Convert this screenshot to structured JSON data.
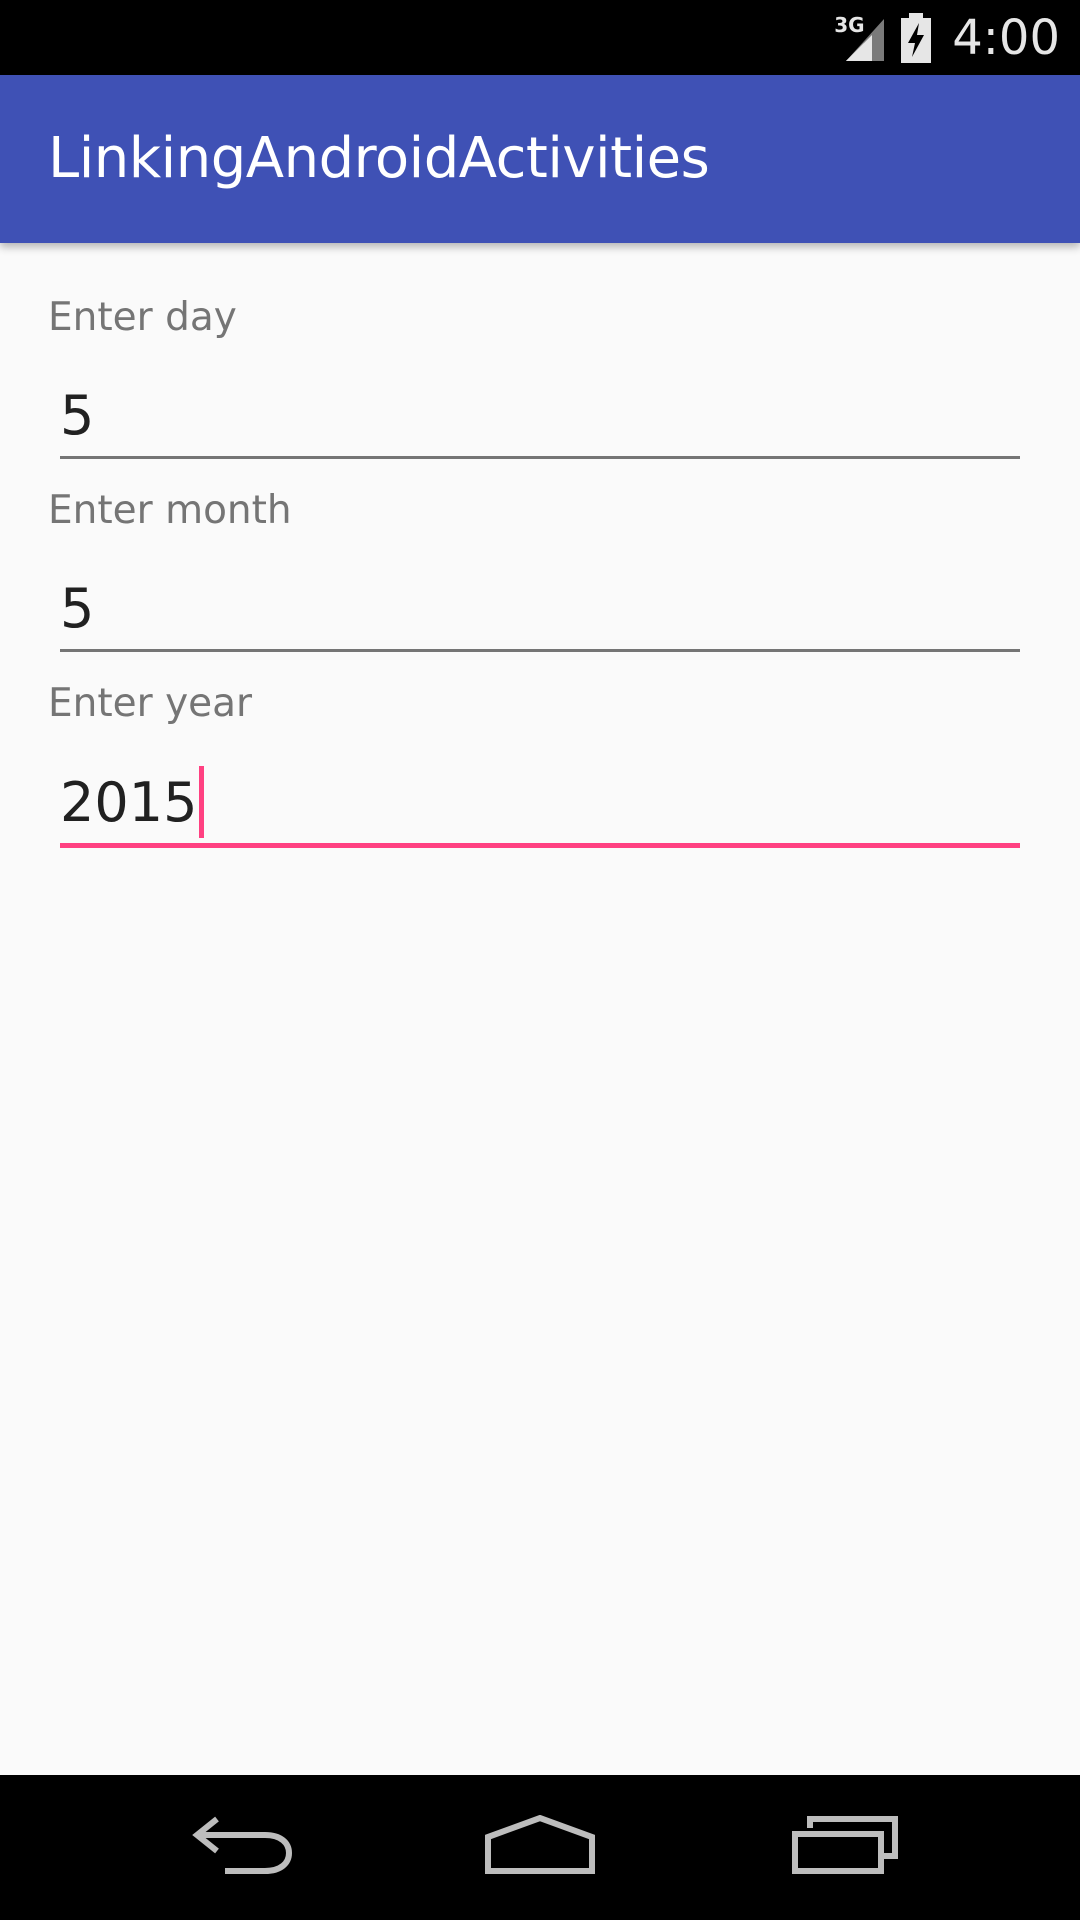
{
  "status_bar": {
    "network": "3G",
    "time": "4:00",
    "icons": [
      "signal-3g-icon",
      "battery-charging-icon"
    ]
  },
  "app_bar": {
    "title": "LinkingAndroidActivities",
    "color": "#3f51b5"
  },
  "form": {
    "fields": [
      {
        "label": "Enter day",
        "value": "5",
        "focused": false
      },
      {
        "label": "Enter month",
        "value": "5",
        "focused": false
      },
      {
        "label": "Enter year",
        "value": "2015",
        "focused": true
      }
    ],
    "accent_color": "#ff4081"
  },
  "nav_bar": {
    "icons": [
      "back-icon",
      "home-icon",
      "recents-icon"
    ]
  }
}
